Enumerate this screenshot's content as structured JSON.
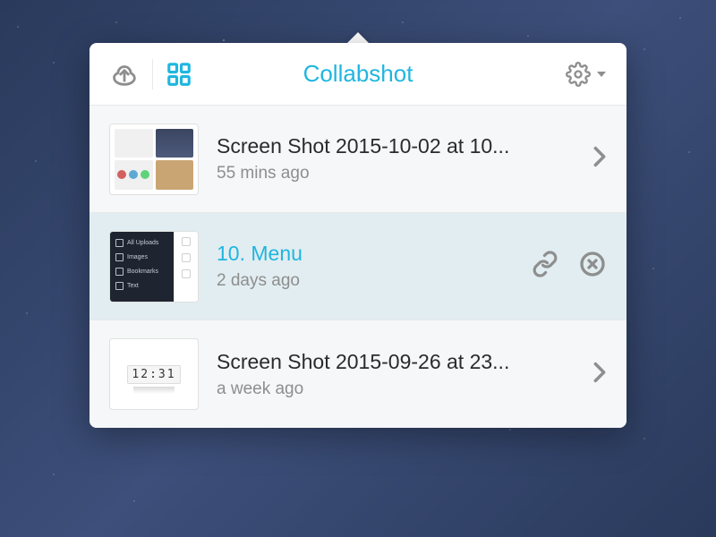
{
  "header": {
    "title": "Collabshot"
  },
  "items": [
    {
      "title": "Screen Shot 2015-10-02 at 10...",
      "time": "55 mins ago",
      "selected": false
    },
    {
      "title": "10. Menu",
      "time": "2 days ago",
      "selected": true,
      "thumb_menu": {
        "row1": "All Uploads",
        "row2": "Images",
        "row3": "Bookmarks",
        "row4": "Text"
      }
    },
    {
      "title": "Screen Shot 2015-09-26 at 23...",
      "time": "a week ago",
      "selected": false,
      "clock_text": "12:31"
    }
  ]
}
